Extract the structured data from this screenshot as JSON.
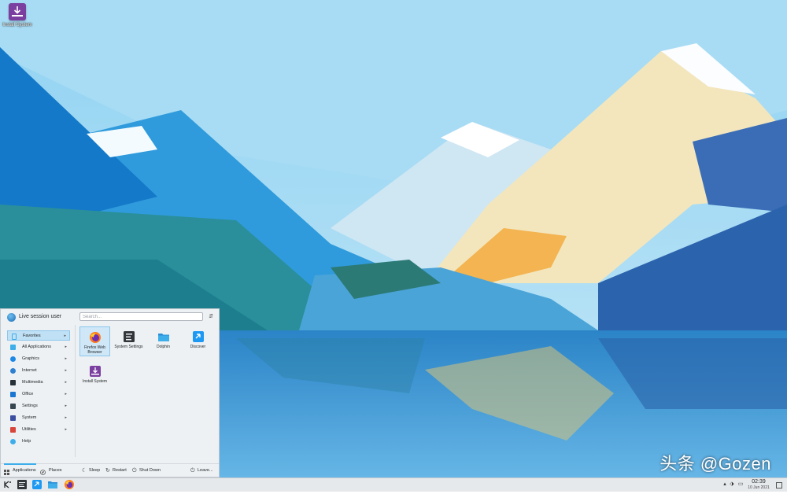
{
  "desktop": {
    "icons": [
      {
        "label": "Install System",
        "icon": "install-system-icon"
      }
    ],
    "watermark": "头条 @Gozen"
  },
  "launcher": {
    "user": "Live session user",
    "search_placeholder": "Search...",
    "categories": [
      {
        "label": "Favorites",
        "icon": "favorites-icon",
        "color": "#3daee9"
      },
      {
        "label": "All Applications",
        "icon": "all-applications-icon",
        "color": "#3daee9"
      },
      {
        "label": "Graphics",
        "icon": "graphics-icon",
        "color": "#1e88e5"
      },
      {
        "label": "Internet",
        "icon": "internet-icon",
        "color": "#2d7fd0"
      },
      {
        "label": "Multimedia",
        "icon": "multimedia-icon",
        "color": "#263238"
      },
      {
        "label": "Office",
        "icon": "office-icon",
        "color": "#1976d2"
      },
      {
        "label": "Settings",
        "icon": "settings-icon",
        "color": "#37474f"
      },
      {
        "label": "System",
        "icon": "system-icon",
        "color": "#3b4ea0"
      },
      {
        "label": "Utilities",
        "icon": "utilities-icon",
        "color": "#d8453a"
      },
      {
        "label": "Help",
        "icon": "help-icon",
        "color": "#3daee9"
      }
    ],
    "apps": [
      {
        "label": "Firefox Web Browser",
        "icon": "firefox-icon"
      },
      {
        "label": "System Settings",
        "icon": "system-settings-icon"
      },
      {
        "label": "Dolphin",
        "icon": "dolphin-icon"
      },
      {
        "label": "Discover",
        "icon": "discover-icon"
      },
      {
        "label": "Install System",
        "icon": "install-system-icon"
      }
    ],
    "tabs": [
      {
        "label": "Applications",
        "icon": "applications-icon"
      },
      {
        "label": "Places",
        "icon": "places-icon"
      }
    ],
    "power": {
      "sleep": "Sleep",
      "restart": "Restart",
      "shutdown": "Shut Down",
      "leave": "Leave..."
    }
  },
  "taskbar": {
    "time": "02:39",
    "date": "10 Jun 2021",
    "colors": {
      "accent": "#3daee9",
      "panel": "#e6e9ec"
    }
  }
}
